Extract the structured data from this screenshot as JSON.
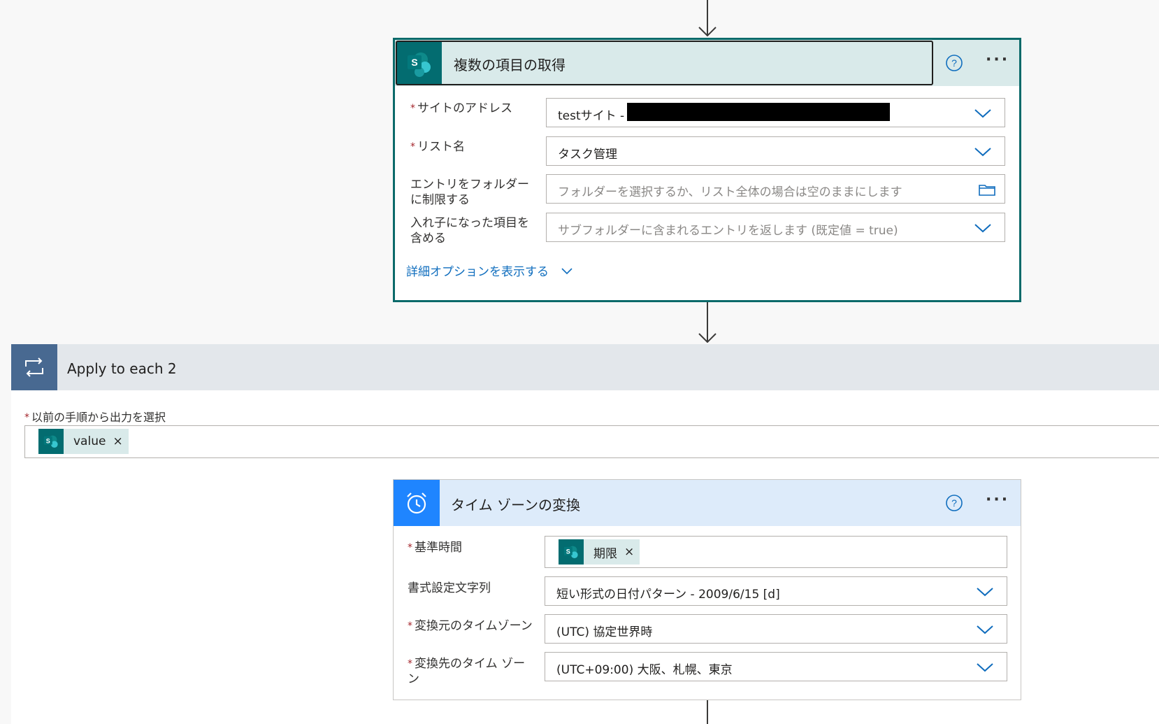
{
  "get_items": {
    "title": "複数の項目の取得",
    "app_icon": "sharepoint-icon",
    "fields": [
      {
        "label": "サイトのアドレス",
        "required": true,
        "value": "testサイト -",
        "redacted": true
      },
      {
        "label": "リスト名",
        "required": true,
        "value": "タスク管理"
      },
      {
        "label_line1": "エントリをフォルダー",
        "label_line2": "に制限する",
        "required": false,
        "placeholder": "フォルダーを選択するか、リスト全体の場合は空のままにします"
      },
      {
        "label_line1": "入れ子になった項目を",
        "label_line2": "含める",
        "required": false,
        "placeholder": "サブフォルダーに含まれるエントリを返します (既定値 = true)"
      }
    ],
    "advanced_link": "詳細オプションを表示する"
  },
  "apply_to_each": {
    "title": "Apply to each 2",
    "field_label": "以前の手順から出力を選択",
    "token": {
      "label": "value",
      "remove": "×"
    }
  },
  "convert_timezone": {
    "title": "タイム ゾーンの変換",
    "fields": [
      {
        "label": "基準時間",
        "required": true,
        "token": "期限",
        "remove": "×"
      },
      {
        "label": "書式設定文字列",
        "required": false,
        "value": "短い形式の日付パターン - 2009/6/15 [d]"
      },
      {
        "label": "変換元のタイムゾーン",
        "required": true,
        "value": "(UTC) 協定世界時"
      },
      {
        "label_line1": "変換先のタイム ゾー",
        "label_line2": "ン",
        "required": true,
        "value": "(UTC+09:00) 大阪、札幌、東京"
      }
    ]
  },
  "common": {
    "required_mark": "*",
    "help": "?",
    "more": "···"
  },
  "colors": {
    "accent_sharepoint": "#036c70",
    "loop_blue": "#486991",
    "schedule_blue": "#1f85ff",
    "link": "#106ebe"
  }
}
